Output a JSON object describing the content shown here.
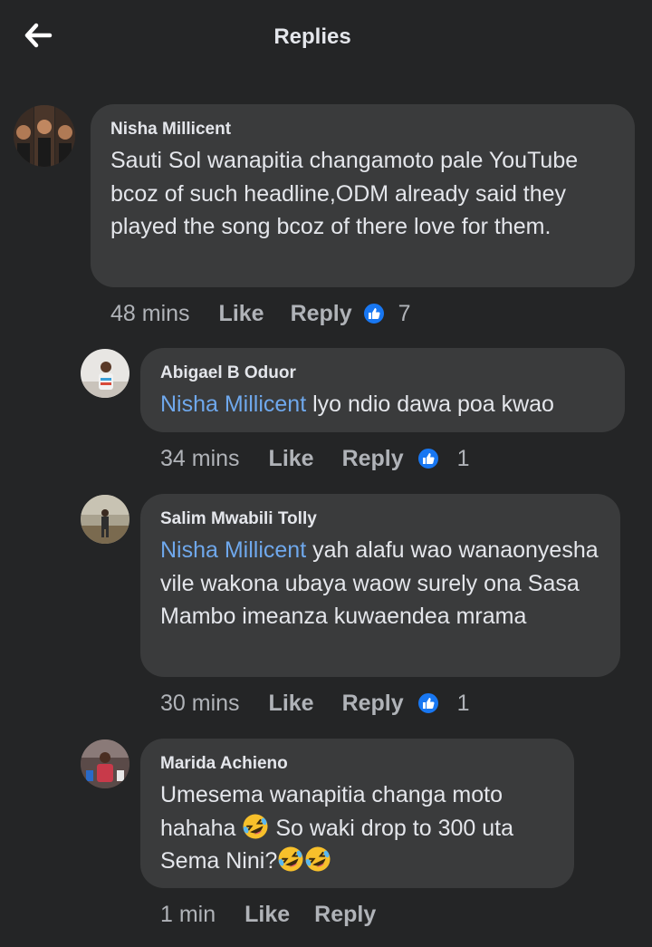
{
  "header": {
    "title": "Replies",
    "back_icon": "arrow-left-icon"
  },
  "colors": {
    "background": "#242526",
    "bubble": "#3a3b3c",
    "mention": "#6fa8ec",
    "like_blue": "#1877f2",
    "muted": "#b0b3b8"
  },
  "comments": [
    {
      "author": "Nisha Millicent",
      "text": "Sauti Sol wanapitia changamoto pale YouTube bcoz of such headline,ODM already said they played the song bcoz of there love for them.",
      "time": "48 mins",
      "like": "Like",
      "reply": "Reply",
      "reactions": "7"
    },
    {
      "author": "Abigael B Oduor",
      "mention": "Nisha Millicent",
      "text": " lyo ndio dawa poa kwao",
      "time": "34 mins",
      "like": "Like",
      "reply": "Reply",
      "reactions": "1"
    },
    {
      "author": "Salim Mwabili Tolly",
      "mention": "Nisha Millicent",
      "text": " yah alafu wao wanaonyesha vile wakona ubaya waow surely ona Sasa Mambo imeanza kuwaendea mrama",
      "time": "30 mins",
      "like": "Like",
      "reply": "Reply",
      "reactions": "1"
    },
    {
      "author": "Marida Achieno",
      "text_part1": "Umesema wanapitia changa moto hahaha ",
      "text_part2": " So waki drop to 300 uta Sema Nini?",
      "emoji": "rolling-laughing-emoji",
      "time": "1 min",
      "like": "Like",
      "reply": "Reply"
    }
  ]
}
